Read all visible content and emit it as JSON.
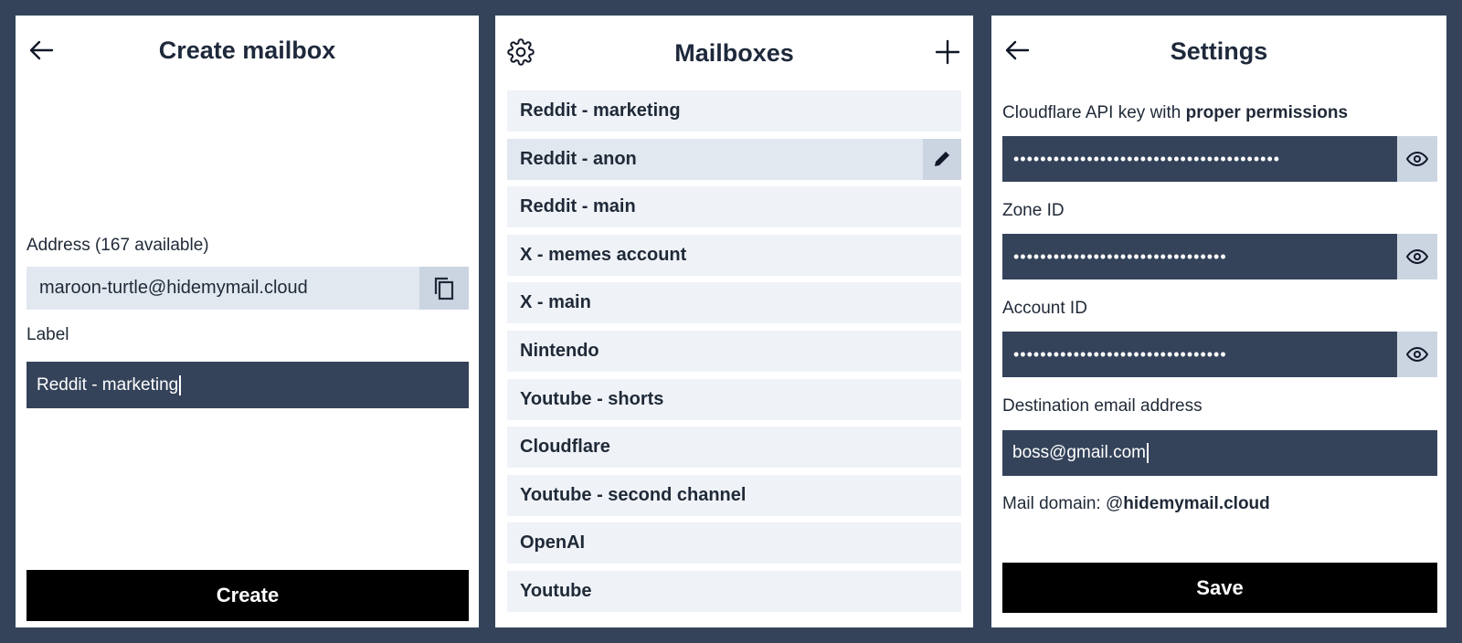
{
  "create_mailbox": {
    "title": "Create mailbox",
    "address_label": "Address (167 available)",
    "address_value": "maroon-turtle@hidemymail.cloud",
    "label_label": "Label",
    "label_value": "Reddit - marketing",
    "create_button": "Create"
  },
  "mailboxes": {
    "title": "Mailboxes",
    "items": [
      {
        "label": "Reddit - marketing"
      },
      {
        "label": "Reddit - anon"
      },
      {
        "label": "Reddit - main"
      },
      {
        "label": "X - memes account"
      },
      {
        "label": "X - main"
      },
      {
        "label": "Nintendo"
      },
      {
        "label": "Youtube - shorts"
      },
      {
        "label": "Cloudflare"
      },
      {
        "label": "Youtube - second channel"
      },
      {
        "label": "OpenAI"
      },
      {
        "label": "Youtube"
      }
    ]
  },
  "settings": {
    "title": "Settings",
    "api_key_label_prefix": "Cloudflare API key with ",
    "api_key_label_bold": "proper permissions",
    "api_key_masked": "••••••••••••••••••••••••••••••••••••••••",
    "zone_id_label": "Zone ID",
    "zone_id_masked": "••••••••••••••••••••••••••••••••",
    "account_id_label": "Account ID",
    "account_id_masked": "••••••••••••••••••••••••••••••••",
    "destination_label": "Destination email address",
    "destination_value": "boss@gmail.com",
    "mail_domain_prefix": "Mail domain: @",
    "mail_domain_bold": "hidemymail.cloud",
    "save_button": "Save"
  },
  "icons": {
    "back": "arrow-left-icon",
    "settings": "gear-icon",
    "add": "plus-icon",
    "edit": "pencil-icon",
    "copy": "copy-icon",
    "reveal": "eye-icon"
  },
  "colors": {
    "background": "#34435a",
    "dark_field": "#34435a",
    "light_field": "#e2e8f0",
    "list_item": "#eff3f8",
    "button": "#000000"
  }
}
